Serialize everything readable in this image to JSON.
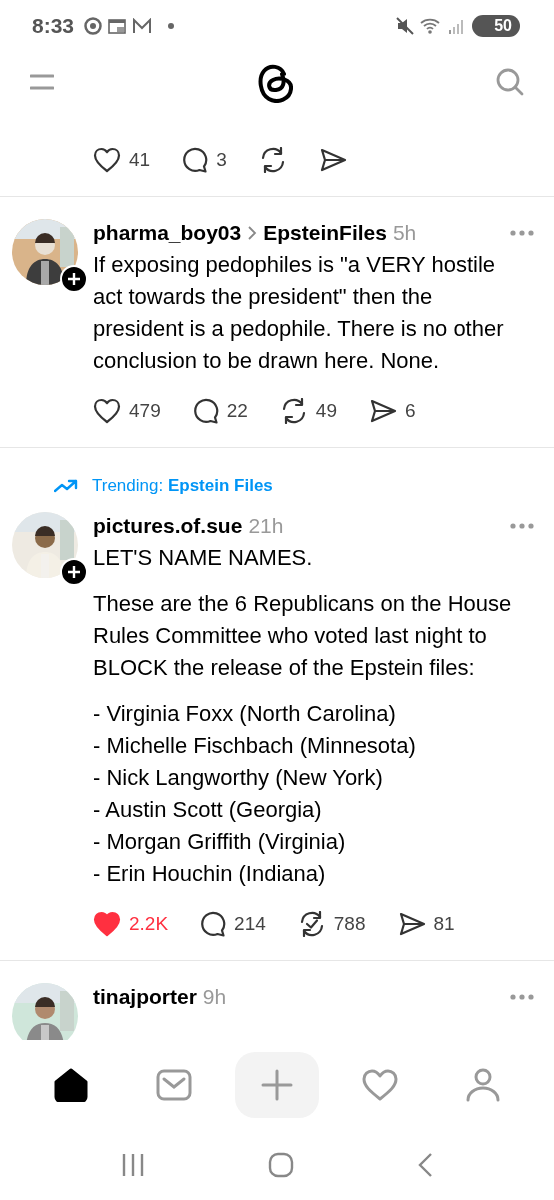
{
  "status_bar": {
    "time": "8:33",
    "battery": "50"
  },
  "posts": [
    {
      "kind": "partial",
      "actions": {
        "liked": false,
        "reposted": false,
        "likes": "41",
        "replies": "3"
      }
    },
    {
      "kind": "post",
      "username": "pharma_boy03",
      "community": "EpsteinFiles",
      "time": "5h",
      "follow_button": true,
      "paragraphs": [
        "If exposing pedophiles is \"a VERY hostile act towards the president\" then the president is a pedophile. There is no other conclusion to be drawn here. None."
      ],
      "actions": {
        "liked": false,
        "reposted": false,
        "likes": "479",
        "replies": "22",
        "reposts": "49",
        "shares": "6"
      }
    },
    {
      "kind": "post",
      "trending": "Trending: **Epstein Files**",
      "username": "pictures.of.sue",
      "time": "21h",
      "follow_button": true,
      "paragraphs": [
        "LET'S NAME NAMES.",
        "These are the 6 Republicans on the House Rules Committee who voted last night to BLOCK the release of the Epstein files:"
      ],
      "list": [
        "- Virginia Foxx (North Carolina)",
        "- Michelle Fischbach (Minnesota)",
        "- Nick Langworthy (New York)",
        "- Austin Scott (Georgia)",
        "- Morgan Griffith (Virginia)",
        "- Erin Houchin (Indiana)"
      ],
      "actions": {
        "liked": true,
        "reposted": true,
        "likes": "2.2K",
        "replies": "214",
        "reposts": "788",
        "shares": "81"
      }
    },
    {
      "kind": "post",
      "username": "tinajporter",
      "time": "9h",
      "follow_button": false
    }
  ],
  "bottom_nav": [
    {
      "kind": "home",
      "selected": true
    },
    {
      "kind": "inbox",
      "selected": false
    },
    {
      "kind": "compose",
      "selected": false
    },
    {
      "kind": "activity",
      "selected": false
    },
    {
      "kind": "profile",
      "selected": false
    }
  ]
}
